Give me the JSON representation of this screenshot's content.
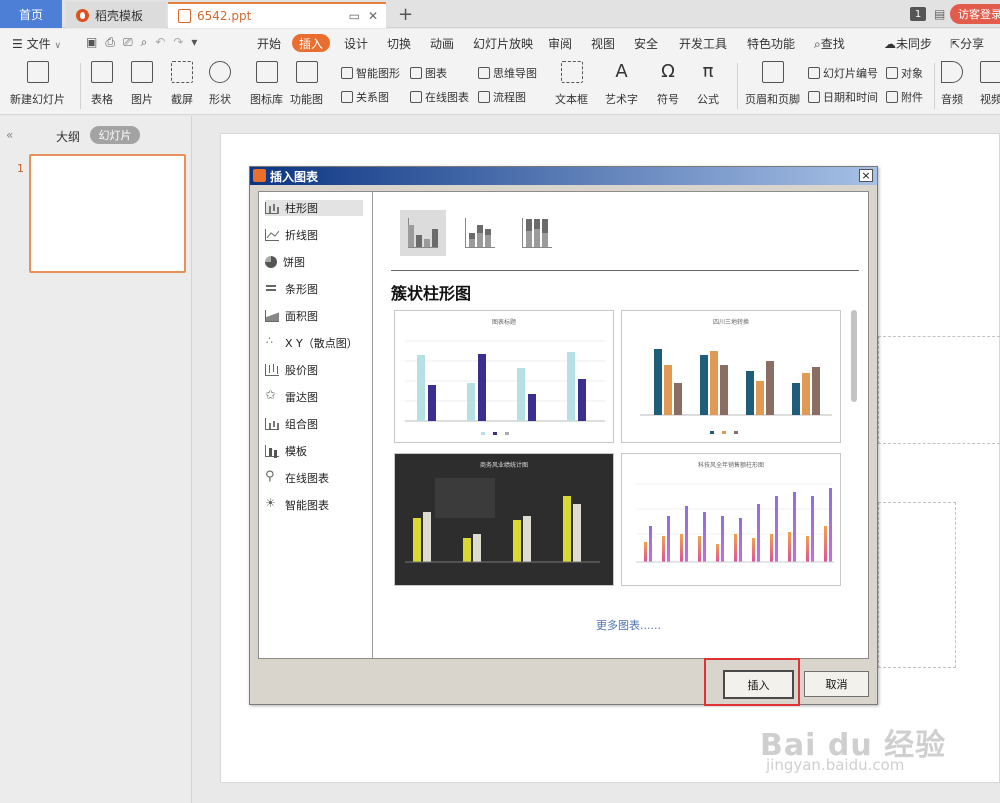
{
  "titlebar": {
    "home_tab": "首页",
    "straw_tab": "稻壳模板",
    "doc_tab": "6542.ppt",
    "page_badge": "1",
    "login_label": "访客登录"
  },
  "menubar": {
    "file": "文件",
    "items": [
      "开始",
      "插入",
      "设计",
      "切换",
      "动画",
      "幻灯片放映",
      "审阅",
      "视图",
      "安全",
      "开发工具",
      "特色功能"
    ],
    "active": "插入",
    "search": "查找",
    "sync": "未同步",
    "share": "分享"
  },
  "ribbon": {
    "new_slide": "新建幻灯片",
    "table": "表格",
    "picture": "图片",
    "screenshot": "截屏",
    "shape": "形状",
    "icon_lib": "图标库",
    "func_chart": "功能图",
    "smart_graphic": "智能图形",
    "relation_chart": "关系图",
    "chart": "图表",
    "online_chart": "在线图表",
    "mindmap": "思维导图",
    "flowchart": "流程图",
    "textbox": "文本框",
    "wordart": "艺术字",
    "symbol": "符号",
    "formula": "公式",
    "header_footer": "页眉和页脚",
    "slide_number": "幻灯片编号",
    "datetime": "日期和时间",
    "object": "对象",
    "attachment": "附件",
    "audio": "音频",
    "video": "视频"
  },
  "leftpanel": {
    "outline_tab": "大纲",
    "slides_tab": "幻灯片",
    "slide_number": "1"
  },
  "dialog": {
    "title": "插入图表",
    "close": "×",
    "categories": [
      "柱形图",
      "折线图",
      "饼图",
      "条形图",
      "面积图",
      "X Y（散点图）",
      "股价图",
      "雷达图",
      "组合图",
      "模板",
      "在线图表",
      "智能图表"
    ],
    "selected_category": "柱形图",
    "section_title": "簇状柱形图",
    "more_charts": "更多图表......",
    "insert_button": "插入",
    "cancel_button": "取消",
    "thumb_titles": [
      "图表标题",
      "四川三地转换",
      "商务风业绩统计图",
      "科技风全年销售额柱形图"
    ]
  },
  "colors": {
    "accent": "#ea6e2f",
    "home_tab": "#4d7fd6",
    "login": "#e25b4b",
    "highlight": "#e03232",
    "dialog_title_start": "#0b3583"
  },
  "watermark": {
    "main": "Bai du 经验",
    "sub": "jingyan.baidu.com"
  }
}
